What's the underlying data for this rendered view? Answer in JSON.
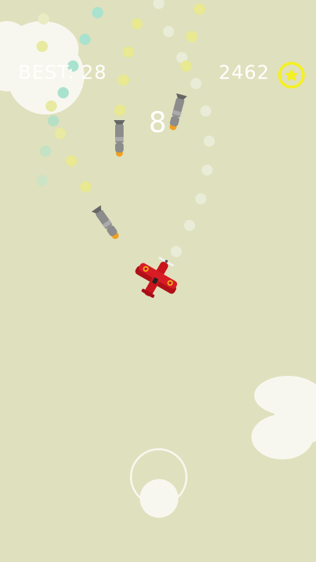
{
  "hud": {
    "best_label": "BEST: 28",
    "coins": "2462",
    "score": "8"
  },
  "colors": {
    "background": "#dfe0bd",
    "coin_accent": "#f5f021",
    "plane": "#c8141c"
  },
  "icons": {
    "coin": "star-coin-icon",
    "plane": "biplane-icon",
    "missile": "missile-icon"
  }
}
